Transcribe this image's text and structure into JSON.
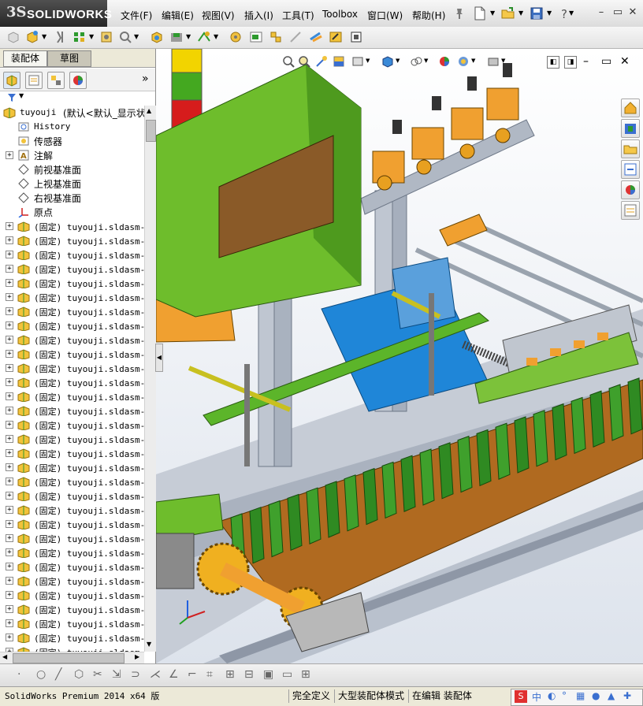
{
  "app": {
    "brand_ds": "3S",
    "brand_name": "SOLIDWORKS"
  },
  "menu": [
    {
      "label": "文件(F)"
    },
    {
      "label": "编辑(E)"
    },
    {
      "label": "视图(V)"
    },
    {
      "label": "插入(I)"
    },
    {
      "label": "工具(T)"
    },
    {
      "label": "Toolbox"
    },
    {
      "label": "窗口(W)"
    },
    {
      "label": "帮助(H)"
    }
  ],
  "window_controls": {
    "minimize": "–",
    "restore": "▭",
    "close": "✕"
  },
  "panel": {
    "tabs": [
      {
        "label": "装配体",
        "active": false
      },
      {
        "label": "草图",
        "active": true
      }
    ],
    "expand_arrow": "»",
    "tree_root": {
      "name": "tuyouji",
      "suffix": "(默认<默认_显示状"
    },
    "tree_items": [
      {
        "label": "History",
        "icon": "history-icon",
        "cn": false,
        "expandable": false
      },
      {
        "label": "传感器",
        "icon": "sensor-icon",
        "cn": true,
        "expandable": false
      },
      {
        "label": "注解",
        "icon": "annotation-icon",
        "cn": true,
        "expandable": true
      },
      {
        "label": "前视基准面",
        "icon": "plane-icon",
        "cn": true,
        "expandable": false
      },
      {
        "label": "上视基准面",
        "icon": "plane-icon",
        "cn": true,
        "expandable": false
      },
      {
        "label": "右视基准面",
        "icon": "plane-icon",
        "cn": true,
        "expandable": false
      },
      {
        "label": "原点",
        "icon": "origin-icon",
        "cn": true,
        "expandable": false
      }
    ],
    "component_label": "(固定) tuyouji.sldasm-P",
    "component_count": 31
  },
  "status": {
    "product": "SolidWorks Premium 2014 x64 版",
    "definition": "完全定义",
    "mode": "大型装配体模式",
    "editing": "在编辑 装配体"
  },
  "colors": {
    "housing_green": "#5cb52a",
    "frame_orange": "#f0a030",
    "rail_gray": "#b8c0cc",
    "accent_blue": "#1f86d8"
  }
}
